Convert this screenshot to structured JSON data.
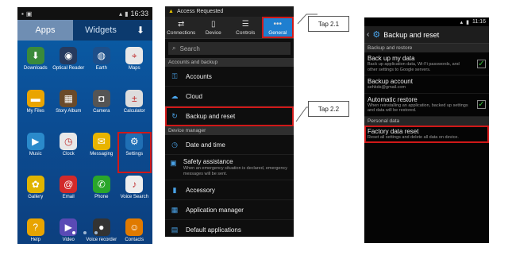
{
  "colors": {
    "highlight": "#d01818",
    "accent": "#1f7fd0",
    "check": "#37c13a"
  },
  "screen1": {
    "status_time": "16:33",
    "tabs": [
      "Apps",
      "Widgets"
    ],
    "download_icon": "download-icon",
    "apps": [
      {
        "label": "Downloads",
        "icon": "download-icon",
        "color": "#3a8a3a",
        "glyph": "⬇"
      },
      {
        "label": "Optical Reader",
        "icon": "optical-reader-icon",
        "color": "#263a5e",
        "glyph": "◉"
      },
      {
        "label": "Earth",
        "icon": "earth-icon",
        "color": "#1d4f8a",
        "glyph": "◍"
      },
      {
        "label": "Maps",
        "icon": "maps-icon",
        "color": "#e8e8e8",
        "glyph": "⌖"
      },
      {
        "label": "My Files",
        "icon": "folder-icon",
        "color": "#e9a400",
        "glyph": "▬"
      },
      {
        "label": "Story Album",
        "icon": "album-icon",
        "color": "#6a4a2a",
        "glyph": "▦"
      },
      {
        "label": "Camera",
        "icon": "camera-icon",
        "color": "#555555",
        "glyph": "◘"
      },
      {
        "label": "Calculator",
        "icon": "calculator-icon",
        "color": "#dddddd",
        "glyph": "±"
      },
      {
        "label": "Music",
        "icon": "music-icon",
        "color": "#2a8acb",
        "glyph": "▶"
      },
      {
        "label": "Clock",
        "icon": "clock-icon",
        "color": "#e8e8e8",
        "glyph": "◷"
      },
      {
        "label": "Messaging",
        "icon": "messaging-icon",
        "color": "#e8b400",
        "glyph": "✉"
      },
      {
        "label": "Settings",
        "icon": "gear-icon",
        "color": "#1f6fb5",
        "glyph": "⚙"
      },
      {
        "label": "Gallery",
        "icon": "gallery-icon",
        "color": "#e0b400",
        "glyph": "✿"
      },
      {
        "label": "Email",
        "icon": "email-icon",
        "color": "#d22a2a",
        "glyph": "@"
      },
      {
        "label": "Phone",
        "icon": "phone-icon",
        "color": "#2aa62a",
        "glyph": "✆"
      },
      {
        "label": "Voice Search",
        "icon": "microphone-icon",
        "color": "#eeeeee",
        "glyph": "♪"
      },
      {
        "label": "Help",
        "icon": "help-icon",
        "color": "#e8a400",
        "glyph": "?"
      },
      {
        "label": "Video",
        "icon": "video-icon",
        "color": "#5a4ab5",
        "glyph": "▶"
      },
      {
        "label": "Voice recorder",
        "icon": "voice-recorder-icon",
        "color": "#333333",
        "glyph": "●"
      },
      {
        "label": "Contacts",
        "icon": "contacts-icon",
        "color": "#e07a00",
        "glyph": "☺"
      }
    ]
  },
  "screen2": {
    "notification": "Access Requested",
    "tabs": [
      {
        "label": "Connections",
        "icon": "connections-icon",
        "glyph": "⇄"
      },
      {
        "label": "Device",
        "icon": "device-icon",
        "glyph": "▯"
      },
      {
        "label": "Controls",
        "icon": "controls-icon",
        "glyph": "☰"
      },
      {
        "label": "General",
        "icon": "more-icon",
        "glyph": "•••"
      }
    ],
    "search_placeholder": "Search",
    "section_accounts": "Accounts and backup",
    "accounts_rows": [
      {
        "label": "Accounts",
        "icon": "key-icon",
        "glyph": "⚿"
      },
      {
        "label": "Cloud",
        "icon": "cloud-icon",
        "glyph": "☁"
      },
      {
        "label": "Backup and reset",
        "icon": "backup-icon",
        "glyph": "↻"
      }
    ],
    "section_device": "Device manager",
    "device_rows": [
      {
        "label": "Date and time",
        "icon": "clock-icon",
        "glyph": "◷",
        "sub": ""
      },
      {
        "label": "Safety assistance",
        "icon": "safety-icon",
        "glyph": "▣",
        "sub": "When an emergency situation is declared, emergency messages will be sent."
      },
      {
        "label": "Accessory",
        "icon": "accessory-icon",
        "glyph": "▮",
        "sub": ""
      },
      {
        "label": "Application manager",
        "icon": "apps-icon",
        "glyph": "▦",
        "sub": ""
      },
      {
        "label": "Default applications",
        "icon": "default-apps-icon",
        "glyph": "▤",
        "sub": ""
      }
    ]
  },
  "screen3": {
    "status_time": "11:16",
    "header_title": "Backup and reset",
    "section_backup": "Backup and restore",
    "backup_rows": [
      {
        "title": "Back up my data",
        "sub": "Back up application data, Wi-Fi passwords, and other settings to Google servers.",
        "checked": true
      },
      {
        "title": "Backup account",
        "sub": "sehkds@gmail.com",
        "checked": false
      },
      {
        "title": "Automatic restore",
        "sub": "When reinstalling an application, backed up settings and data will be restored.",
        "checked": true
      }
    ],
    "section_personal": "Personal data",
    "factory": {
      "title": "Factory data reset",
      "sub": "Reset all settings and delete all data on device."
    }
  },
  "callouts": [
    "Tap 2.1",
    "Tap 2.2"
  ]
}
